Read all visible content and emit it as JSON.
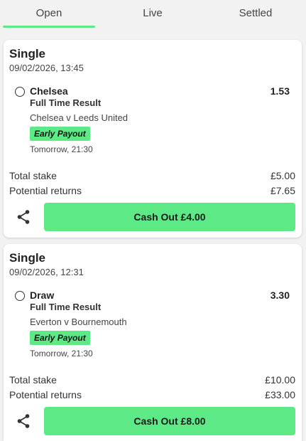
{
  "tabs": {
    "open": "Open",
    "live": "Live",
    "settled": "Settled",
    "active": "Open"
  },
  "colors": {
    "accent": "#5ce986",
    "background": "#f2f2f2",
    "card": "#ffffff"
  },
  "bets": [
    {
      "type": "Single",
      "placed": "09/02/2026, 13:45",
      "selection": "Chelsea",
      "odds": "1.53",
      "market": "Full Time Result",
      "event": "Chelsea v Leeds United",
      "badge": "Early Payout",
      "event_time": "Tomorrow, 21:30",
      "stake_label": "Total stake",
      "stake": "£5.00",
      "returns_label": "Potential returns",
      "returns": "£7.65",
      "cashout_label": "Cash Out £4.00",
      "share_icon": "share-icon"
    },
    {
      "type": "Single",
      "placed": "09/02/2026, 12:31",
      "selection": "Draw",
      "odds": "3.30",
      "market": "Full Time Result",
      "event": "Everton v Bournemouth",
      "badge": "Early Payout",
      "event_time": "Tomorrow, 21:30",
      "stake_label": "Total stake",
      "stake": "£10.00",
      "returns_label": "Potential returns",
      "returns": "£33.00",
      "cashout_label": "Cash Out £8.00",
      "share_icon": "share-icon"
    }
  ]
}
